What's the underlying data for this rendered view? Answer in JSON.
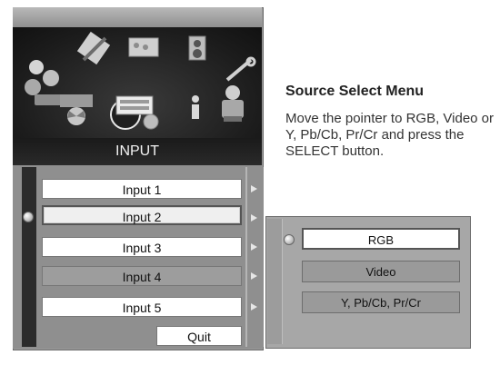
{
  "main_menu": {
    "caption": "INPUT",
    "items": [
      {
        "label": "Input 1"
      },
      {
        "label": "Input 2"
      },
      {
        "label": "Input 3"
      },
      {
        "label": "Input 4"
      },
      {
        "label": "Input 5"
      }
    ],
    "quit_label": "Quit"
  },
  "submenu": {
    "items": [
      {
        "label": "RGB"
      },
      {
        "label": "Video"
      },
      {
        "label": "Y, Pb/Cb, Pr/Cr"
      }
    ]
  },
  "info": {
    "heading": "Source Select Menu",
    "description": "Move the pointer to RGB, Video or Y, Pb/Cb, Pr/Cr and press the SELECT button."
  },
  "icons": [
    "people-icon",
    "tools-icon",
    "image-icon",
    "speaker-icon",
    "wrench-icon",
    "fan-icon",
    "input-icon",
    "info-icon",
    "setting-icon"
  ]
}
